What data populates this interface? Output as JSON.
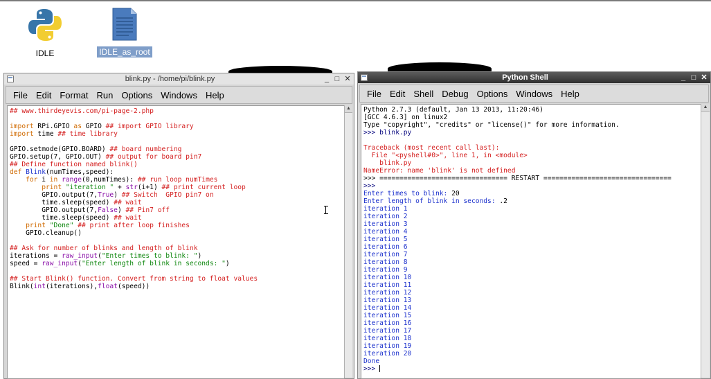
{
  "desktop": {
    "icons": [
      {
        "label": "IDLE",
        "icon": "python-logo-icon",
        "selected": false
      },
      {
        "label": "IDLE_as_root",
        "icon": "document-file-icon",
        "selected": true
      }
    ]
  },
  "editor_window": {
    "title": "blink.py - /home/pi/blink.py",
    "menu": [
      "File",
      "Edit",
      "Format",
      "Run",
      "Options",
      "Windows",
      "Help"
    ],
    "code_lines": [
      [
        {
          "t": "## www.thirdeyevis.com/pi-page-2.php",
          "c": "red"
        }
      ],
      [
        {
          "t": "",
          "c": "black"
        }
      ],
      [
        {
          "t": "import",
          "c": "orange"
        },
        {
          "t": " RPi.GPIO ",
          "c": "black"
        },
        {
          "t": "as",
          "c": "orange"
        },
        {
          "t": " GPIO ",
          "c": "black"
        },
        {
          "t": "## import GPIO library",
          "c": "red"
        }
      ],
      [
        {
          "t": "import",
          "c": "orange"
        },
        {
          "t": " time ",
          "c": "black"
        },
        {
          "t": "## time library",
          "c": "red"
        }
      ],
      [
        {
          "t": "",
          "c": "black"
        }
      ],
      [
        {
          "t": "GPIO.setmode(GPIO.BOARD) ",
          "c": "black"
        },
        {
          "t": "## board numbering",
          "c": "red"
        }
      ],
      [
        {
          "t": "GPIO.setup(7, GPIO.OUT) ",
          "c": "black"
        },
        {
          "t": "## output for board pin7",
          "c": "red"
        }
      ],
      [
        {
          "t": "## Define function named blink()",
          "c": "red"
        }
      ],
      [
        {
          "t": "def",
          "c": "orange"
        },
        {
          "t": " ",
          "c": "black"
        },
        {
          "t": "Blink",
          "c": "blue"
        },
        {
          "t": "(numTimes,speed):",
          "c": "black"
        }
      ],
      [
        {
          "t": "    ",
          "c": "black"
        },
        {
          "t": "for",
          "c": "orange"
        },
        {
          "t": " i ",
          "c": "black"
        },
        {
          "t": "in",
          "c": "orange"
        },
        {
          "t": " ",
          "c": "black"
        },
        {
          "t": "range",
          "c": "purple"
        },
        {
          "t": "(0,numTimes): ",
          "c": "black"
        },
        {
          "t": "## run loop numTimes",
          "c": "red"
        }
      ],
      [
        {
          "t": "        ",
          "c": "black"
        },
        {
          "t": "print",
          "c": "orange"
        },
        {
          "t": " ",
          "c": "black"
        },
        {
          "t": "\"iteration \"",
          "c": "green"
        },
        {
          "t": " + ",
          "c": "black"
        },
        {
          "t": "str",
          "c": "purple"
        },
        {
          "t": "(i+1) ",
          "c": "black"
        },
        {
          "t": "## print current loop",
          "c": "red"
        }
      ],
      [
        {
          "t": "        GPIO.output(7,",
          "c": "black"
        },
        {
          "t": "True",
          "c": "purple"
        },
        {
          "t": ") ",
          "c": "black"
        },
        {
          "t": "## Switch  GPIO pin7 on",
          "c": "red"
        }
      ],
      [
        {
          "t": "        time.sleep(speed) ",
          "c": "black"
        },
        {
          "t": "## wait",
          "c": "red"
        }
      ],
      [
        {
          "t": "        GPIO.output(7,",
          "c": "black"
        },
        {
          "t": "False",
          "c": "purple"
        },
        {
          "t": ") ",
          "c": "black"
        },
        {
          "t": "## Pin7 off",
          "c": "red"
        }
      ],
      [
        {
          "t": "        time.sleep(speed) ",
          "c": "black"
        },
        {
          "t": "## wait",
          "c": "red"
        }
      ],
      [
        {
          "t": "    ",
          "c": "black"
        },
        {
          "t": "print",
          "c": "orange"
        },
        {
          "t": " ",
          "c": "black"
        },
        {
          "t": "\"Done\"",
          "c": "green"
        },
        {
          "t": " ",
          "c": "black"
        },
        {
          "t": "## print after loop finishes",
          "c": "red"
        }
      ],
      [
        {
          "t": "    GPIO.cleanup()",
          "c": "black"
        }
      ],
      [
        {
          "t": "",
          "c": "black"
        }
      ],
      [
        {
          "t": "## Ask for number of blinks and length of blink",
          "c": "red"
        }
      ],
      [
        {
          "t": "iterations = ",
          "c": "black"
        },
        {
          "t": "raw_input",
          "c": "purple"
        },
        {
          "t": "(",
          "c": "black"
        },
        {
          "t": "\"Enter times to blink: \"",
          "c": "green"
        },
        {
          "t": ")",
          "c": "black"
        }
      ],
      [
        {
          "t": "speed = ",
          "c": "black"
        },
        {
          "t": "raw_input",
          "c": "purple"
        },
        {
          "t": "(",
          "c": "black"
        },
        {
          "t": "\"Enter length of blink in seconds: \"",
          "c": "green"
        },
        {
          "t": ")",
          "c": "black"
        }
      ],
      [
        {
          "t": "",
          "c": "black"
        }
      ],
      [
        {
          "t": "## Start Blink() function. Convert from string to float values",
          "c": "red"
        }
      ],
      [
        {
          "t": "Blink(",
          "c": "black"
        },
        {
          "t": "int",
          "c": "purple"
        },
        {
          "t": "(iterations),",
          "c": "black"
        },
        {
          "t": "float",
          "c": "purple"
        },
        {
          "t": "(speed))",
          "c": "black"
        }
      ]
    ]
  },
  "shell_window": {
    "title": "Python Shell",
    "menu": [
      "File",
      "Edit",
      "Shell",
      "Debug",
      "Options",
      "Windows",
      "Help"
    ],
    "lines": [
      [
        {
          "t": "Python 2.7.3 (default, Jan 13 2013, 11:20:46)",
          "c": "black"
        }
      ],
      [
        {
          "t": "[GCC 4.6.3] on linux2",
          "c": "black"
        }
      ],
      [
        {
          "t": "Type \"copyright\", \"credits\" or \"license()\" for more information.",
          "c": "black"
        }
      ],
      [
        {
          "t": ">>> blink.py",
          "c": "dblue"
        }
      ],
      [
        {
          "t": "",
          "c": "black"
        }
      ],
      [
        {
          "t": "Traceback (most recent call last):",
          "c": "red"
        }
      ],
      [
        {
          "t": "  File \"<pyshell#0>\", line 1, in <module>",
          "c": "red"
        }
      ],
      [
        {
          "t": "    blink.py",
          "c": "red"
        }
      ],
      [
        {
          "t": "NameError: name 'blink' is not defined",
          "c": "red"
        }
      ],
      [
        {
          "t": ">>> ================================ RESTART ================================",
          "c": "black"
        }
      ],
      [
        {
          "t": ">>>",
          "c": "dblue"
        }
      ],
      [
        {
          "t": "Enter times to blink: ",
          "c": "blue"
        },
        {
          "t": "20",
          "c": "black"
        }
      ],
      [
        {
          "t": "Enter length of blink in seconds: ",
          "c": "blue"
        },
        {
          "t": ".2",
          "c": "black"
        }
      ],
      [
        {
          "t": "iteration 1",
          "c": "blue"
        }
      ],
      [
        {
          "t": "iteration 2",
          "c": "blue"
        }
      ],
      [
        {
          "t": "iteration 3",
          "c": "blue"
        }
      ],
      [
        {
          "t": "iteration 4",
          "c": "blue"
        }
      ],
      [
        {
          "t": "iteration 5",
          "c": "blue"
        }
      ],
      [
        {
          "t": "iteration 6",
          "c": "blue"
        }
      ],
      [
        {
          "t": "iteration 7",
          "c": "blue"
        }
      ],
      [
        {
          "t": "iteration 8",
          "c": "blue"
        }
      ],
      [
        {
          "t": "iteration 9",
          "c": "blue"
        }
      ],
      [
        {
          "t": "iteration 10",
          "c": "blue"
        }
      ],
      [
        {
          "t": "iteration 11",
          "c": "blue"
        }
      ],
      [
        {
          "t": "iteration 12",
          "c": "blue"
        }
      ],
      [
        {
          "t": "iteration 13",
          "c": "blue"
        }
      ],
      [
        {
          "t": "iteration 14",
          "c": "blue"
        }
      ],
      [
        {
          "t": "iteration 15",
          "c": "blue"
        }
      ],
      [
        {
          "t": "iteration 16",
          "c": "blue"
        }
      ],
      [
        {
          "t": "iteration 17",
          "c": "blue"
        }
      ],
      [
        {
          "t": "iteration 18",
          "c": "blue"
        }
      ],
      [
        {
          "t": "iteration 19",
          "c": "blue"
        }
      ],
      [
        {
          "t": "iteration 20",
          "c": "blue"
        }
      ],
      [
        {
          "t": "Done",
          "c": "blue"
        }
      ],
      [
        {
          "t": ">>> ",
          "c": "dblue"
        }
      ]
    ]
  },
  "colors": {
    "comment": "#d42020",
    "keyword": "#d06a00",
    "string": "#118811",
    "builtin": "#8a0fa8",
    "definition_and_output": "#1a2fcc",
    "selection": "#7f9ec9"
  }
}
